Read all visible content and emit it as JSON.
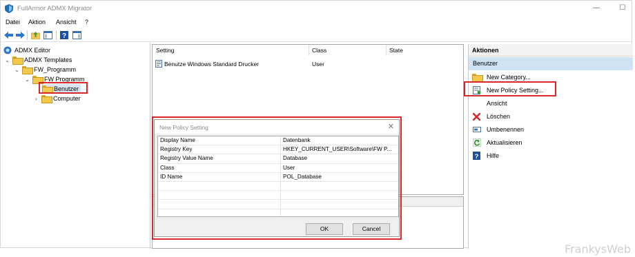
{
  "window": {
    "title": "FullArmor ADMX Migrator"
  },
  "menu": [
    "Datei",
    "Aktion",
    "Ansicht",
    "?"
  ],
  "tree": {
    "root": "ADMX Editor",
    "templates": "ADMX Templates",
    "program": "FW_Programm",
    "category": "FW Programm",
    "selected": "Benutzer",
    "computer": "Computer"
  },
  "list": {
    "columns": [
      "Setting",
      "Class",
      "State"
    ],
    "rows": [
      {
        "setting": "Benutze Windows Standard Drucker",
        "class": "User",
        "state": ""
      }
    ]
  },
  "actions": {
    "header": "Aktionen",
    "section": "Benutzer",
    "items": [
      {
        "label": "New Category...",
        "icon": "folder-icon"
      },
      {
        "label": "New Policy Setting...",
        "icon": "policy-setting-icon"
      },
      {
        "label": "Ansicht",
        "icon": ""
      },
      {
        "label": "Löschen",
        "icon": "delete-x-icon"
      },
      {
        "label": "Umbenennen",
        "icon": "rename-icon"
      },
      {
        "label": "Aktualisieren",
        "icon": "refresh-icon"
      },
      {
        "label": "Hilfe",
        "icon": "help-icon"
      }
    ]
  },
  "dialog": {
    "title": "New Policy Setting",
    "rows": [
      {
        "key": "Display Name",
        "value": "Datenbank"
      },
      {
        "key": "Registry Key",
        "value": "HKEY_CURRENT_USER\\Software\\FW P..."
      },
      {
        "key": "Registry Value Name",
        "value": "Database"
      },
      {
        "key": "Class",
        "value": "User"
      },
      {
        "key": "ID Name",
        "value": "POL_Database"
      }
    ],
    "ok": "OK",
    "cancel": "Cancel"
  },
  "watermark": "FrankysWeb",
  "colors": {
    "highlight_border": "#d9262b",
    "action_section_bg": "#cfe3f4"
  }
}
